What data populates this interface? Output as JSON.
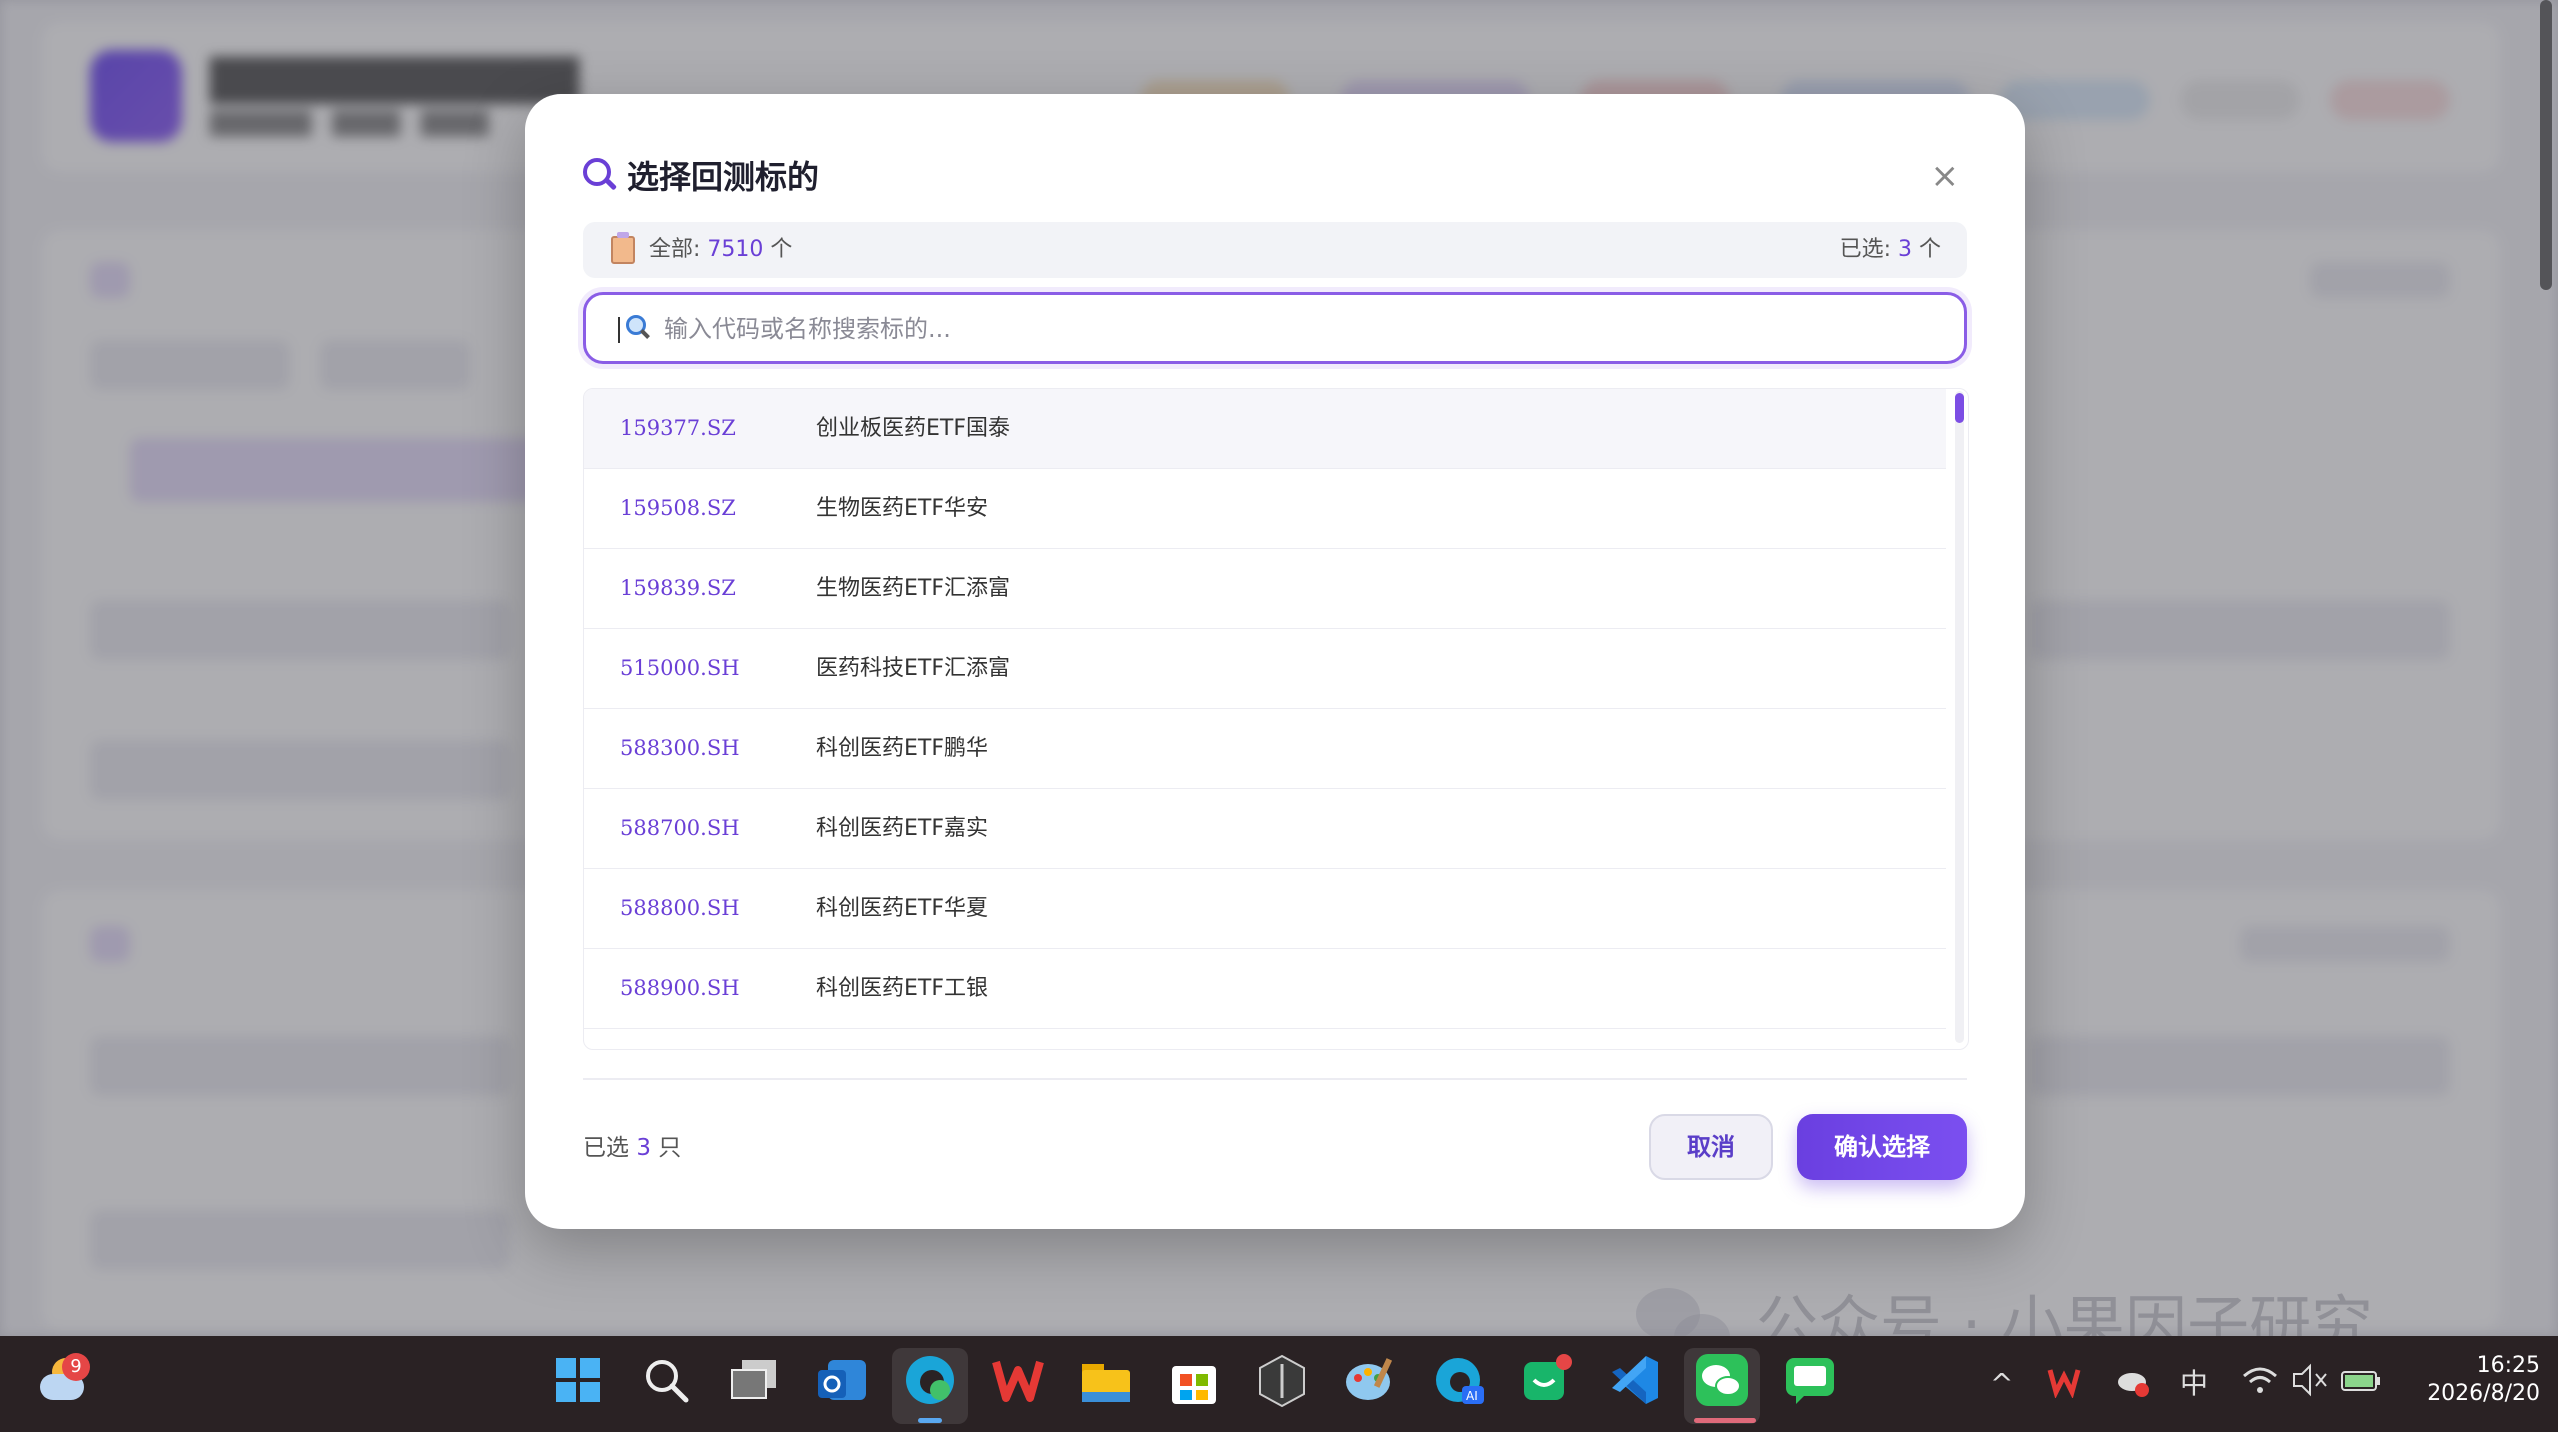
{
  "modal": {
    "title": "选择回测标的",
    "close": "×",
    "summary_prefix": "全部:",
    "total_count": "7510",
    "count_unit": "个",
    "selected_prefix": "已选:",
    "selected_count": "3",
    "search_placeholder": "输入代码或名称搜索标的...",
    "rows": [
      {
        "code": "159377.SZ",
        "name": "创业板医药ETF国泰"
      },
      {
        "code": "159508.SZ",
        "name": "生物医药ETF华安"
      },
      {
        "code": "159839.SZ",
        "name": "生物医药ETF汇添富"
      },
      {
        "code": "515000.SH",
        "name": "医药科技ETF汇添富"
      },
      {
        "code": "588300.SH",
        "name": "科创医药ETF鹏华"
      },
      {
        "code": "588700.SH",
        "name": "科创医药ETF嘉实"
      },
      {
        "code": "588800.SH",
        "name": "科创医药ETF华夏"
      },
      {
        "code": "588900.SH",
        "name": "科创医药ETF工银"
      }
    ],
    "footer_prefix": "已选",
    "footer_count": "3",
    "footer_unit": "只",
    "cancel_label": "取消",
    "confirm_label": "确认选择"
  },
  "watermark": "公众号 · 小果因子研究",
  "taskbar": {
    "weather_badge": "9",
    "ime": "中",
    "time": "16:25",
    "date": "2026/8/20"
  },
  "colors": {
    "accent": "#6a3fd6",
    "taskbar": "#2a2224"
  }
}
